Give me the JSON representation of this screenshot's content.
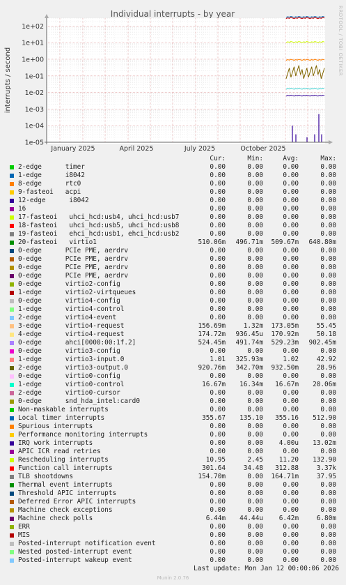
{
  "chart_data": {
    "type": "line",
    "title": "Individual interrupts - by year",
    "ylabel": "interrupts / second",
    "yscale": "log",
    "ylim": [
      1e-05,
      300
    ],
    "y_ticks": [
      "1e+02",
      "1e+01",
      "1e+00",
      "1e-01",
      "1e-02",
      "1e-03",
      "1e-04",
      "1e-05"
    ],
    "x_ticks": [
      "January 2025",
      "April 2025",
      "July 2025",
      "October 2025"
    ],
    "grid": true,
    "side_label": "RRDTOOL / TOBI OETIKER",
    "series": [
      {
        "name": "Function call interrupts",
        "color": "#cc0000",
        "values": [
          301.64
        ]
      },
      {
        "name": "Local timer interrupts",
        "color": "#0066b3",
        "values": [
          355.67
        ]
      },
      {
        "name": "Rescheduling interrupts",
        "color": "#ccff00",
        "values": [
          10.95
        ]
      },
      {
        "name": "virtio3-output.0",
        "color": "#ff8000",
        "values": [
          0.92
        ]
      },
      {
        "name": "virtio4-request",
        "color": "#806600",
        "values": [
          0.17
        ]
      },
      {
        "name": "virtio0-control",
        "color": "#33cccc",
        "values": [
          0.0167
        ]
      },
      {
        "name": "Machine check polls",
        "color": "#330099",
        "values": [
          0.0064
        ]
      }
    ]
  },
  "legend": {
    "headers": [
      "Cur:",
      "Min:",
      "Avg:",
      "Max:"
    ],
    "rows": [
      {
        "label": "2-edge      timer",
        "color": "#00cc00",
        "cur": "0.00",
        "min": "0.00",
        "avg": "0.00",
        "max": "0.00"
      },
      {
        "label": "1-edge      i8042",
        "color": "#0066b3",
        "cur": "0.00",
        "min": "0.00",
        "avg": "0.00",
        "max": "0.00"
      },
      {
        "label": "8-edge      rtc0",
        "color": "#ff8000",
        "cur": "0.00",
        "min": "0.00",
        "avg": "0.00",
        "max": "0.00"
      },
      {
        "label": "9-fasteoi   acpi",
        "color": "#ffcc00",
        "cur": "0.00",
        "min": "0.00",
        "avg": "0.00",
        "max": "0.00"
      },
      {
        "label": "12-edge      i8042",
        "color": "#330099",
        "cur": "0.00",
        "min": "0.00",
        "avg": "0.00",
        "max": "0.00"
      },
      {
        "label": "16",
        "color": "#990099",
        "cur": "0.00",
        "min": "0.00",
        "avg": "0.00",
        "max": "0.00"
      },
      {
        "label": "17-fasteoi   uhci_hcd:usb4, uhci_hcd:usb7",
        "color": "#ccff00",
        "cur": "0.00",
        "min": "0.00",
        "avg": "0.00",
        "max": "0.00"
      },
      {
        "label": "18-fasteoi   uhci_hcd:usb5, uhci_hcd:usb8",
        "color": "#ff0000",
        "cur": "0.00",
        "min": "0.00",
        "avg": "0.00",
        "max": "0.00"
      },
      {
        "label": "19-fasteoi   ehci_hcd:usb1, ehci_hcd:usb2",
        "color": "#808080",
        "cur": "0.00",
        "min": "0.00",
        "avg": "0.00",
        "max": "0.00"
      },
      {
        "label": "20-fasteoi   virtio1",
        "color": "#008f00",
        "cur": "510.06m",
        "min": "496.71m",
        "avg": "509.67m",
        "max": "640.80m"
      },
      {
        "label": "0-edge      PCIe PME, aerdrv",
        "color": "#00487d",
        "cur": "0.00",
        "min": "0.00",
        "avg": "0.00",
        "max": "0.00"
      },
      {
        "label": "0-edge      PCIe PME, aerdrv",
        "color": "#b35a00",
        "cur": "0.00",
        "min": "0.00",
        "avg": "0.00",
        "max": "0.00"
      },
      {
        "label": "0-edge      PCIe PME, aerdrv",
        "color": "#b38f00",
        "cur": "0.00",
        "min": "0.00",
        "avg": "0.00",
        "max": "0.00"
      },
      {
        "label": "0-edge      PCIe PME, aerdrv",
        "color": "#6b006b",
        "cur": "0.00",
        "min": "0.00",
        "avg": "0.00",
        "max": "0.00"
      },
      {
        "label": "0-edge      virtio2-config",
        "color": "#8fb300",
        "cur": "0.00",
        "min": "0.00",
        "avg": "0.00",
        "max": "0.00"
      },
      {
        "label": "1-edge      virtio2-virtqueues",
        "color": "#b30000",
        "cur": "0.00",
        "min": "0.00",
        "avg": "0.00",
        "max": "0.00"
      },
      {
        "label": "0-edge      virtio4-config",
        "color": "#bebebe",
        "cur": "0.00",
        "min": "0.00",
        "avg": "0.00",
        "max": "0.00"
      },
      {
        "label": "1-edge      virtio4-control",
        "color": "#80ff80",
        "cur": "0.00",
        "min": "0.00",
        "avg": "0.00",
        "max": "0.00"
      },
      {
        "label": "2-edge      virtio4-event",
        "color": "#80c9ff",
        "cur": "0.00",
        "min": "0.00",
        "avg": "0.00",
        "max": "0.00"
      },
      {
        "label": "3-edge      virtio4-request",
        "color": "#ffc080",
        "cur": "156.69m",
        "min": "1.32m",
        "avg": "173.05m",
        "max": "55.45"
      },
      {
        "label": "4-edge      virtio4-request",
        "color": "#ffe680",
        "cur": "174.72m",
        "min": "936.45u",
        "avg": "170.92m",
        "max": "50.18"
      },
      {
        "label": "0-edge      ahci[0000:00:1f.2]",
        "color": "#aa80ff",
        "cur": "524.45m",
        "min": "491.74m",
        "avg": "529.23m",
        "max": "902.45m"
      },
      {
        "label": "0-edge      virtio3-config",
        "color": "#ee00cc",
        "cur": "0.00",
        "min": "0.00",
        "avg": "0.00",
        "max": "0.00"
      },
      {
        "label": "1-edge      virtio3-input.0",
        "color": "#ff8080",
        "cur": "1.01",
        "min": "325.93m",
        "avg": "1.02",
        "max": "42.92"
      },
      {
        "label": "2-edge      virtio3-output.0",
        "color": "#666600",
        "cur": "920.76m",
        "min": "342.70m",
        "avg": "932.50m",
        "max": "28.96"
      },
      {
        "label": "0-edge      virtio0-config",
        "color": "#ffbfff",
        "cur": "0.00",
        "min": "0.00",
        "avg": "0.00",
        "max": "0.00"
      },
      {
        "label": "1-edge      virtio0-control",
        "color": "#00ffcc",
        "cur": "16.67m",
        "min": "16.34m",
        "avg": "16.67m",
        "max": "20.06m"
      },
      {
        "label": "2-edge      virtio0-cursor",
        "color": "#cc6699",
        "cur": "0.00",
        "min": "0.00",
        "avg": "0.00",
        "max": "0.00"
      },
      {
        "label": "0-edge      snd_hda_intel:card0",
        "color": "#999900",
        "cur": "0.00",
        "min": "0.00",
        "avg": "0.00",
        "max": "0.00"
      },
      {
        "label": "Non-maskable interrupts",
        "color": "#00cc00",
        "cur": "0.00",
        "min": "0.00",
        "avg": "0.00",
        "max": "0.00"
      },
      {
        "label": "Local timer interrupts",
        "color": "#0066b3",
        "cur": "355.67",
        "min": "135.10",
        "avg": "355.16",
        "max": "512.90"
      },
      {
        "label": "Spurious interrupts",
        "color": "#ff8000",
        "cur": "0.00",
        "min": "0.00",
        "avg": "0.00",
        "max": "0.00"
      },
      {
        "label": "Performance monitoring interrupts",
        "color": "#ffcc00",
        "cur": "0.00",
        "min": "0.00",
        "avg": "0.00",
        "max": "0.00"
      },
      {
        "label": "IRQ work interrupts",
        "color": "#330099",
        "cur": "0.00",
        "min": "0.00",
        "avg": "4.00u",
        "max": "13.02m"
      },
      {
        "label": "APIC ICR read retries",
        "color": "#990099",
        "cur": "0.00",
        "min": "0.00",
        "avg": "0.00",
        "max": "0.00"
      },
      {
        "label": "Rescheduling interrupts",
        "color": "#ccff00",
        "cur": "10.95",
        "min": "2.45",
        "avg": "11.20",
        "max": "132.90"
      },
      {
        "label": "Function call interrupts",
        "color": "#ff0000",
        "cur": "301.64",
        "min": "34.48",
        "avg": "312.88",
        "max": "3.37k"
      },
      {
        "label": "TLB shootdowns",
        "color": "#808080",
        "cur": "154.70m",
        "min": "0.00",
        "avg": "164.71m",
        "max": "37.95"
      },
      {
        "label": "Thermal event interrupts",
        "color": "#008f00",
        "cur": "0.00",
        "min": "0.00",
        "avg": "0.00",
        "max": "0.00"
      },
      {
        "label": "Threshold APIC interrupts",
        "color": "#00487d",
        "cur": "0.00",
        "min": "0.00",
        "avg": "0.00",
        "max": "0.00"
      },
      {
        "label": "Deferred Error APIC interrupts",
        "color": "#b35a00",
        "cur": "0.00",
        "min": "0.00",
        "avg": "0.00",
        "max": "0.00"
      },
      {
        "label": "Machine check exceptions",
        "color": "#b38f00",
        "cur": "0.00",
        "min": "0.00",
        "avg": "0.00",
        "max": "0.00"
      },
      {
        "label": "Machine check polls",
        "color": "#6b006b",
        "cur": "6.44m",
        "min": "44.44u",
        "avg": "6.42m",
        "max": "6.80m"
      },
      {
        "label": "ERR",
        "color": "#8fb300",
        "cur": "0.00",
        "min": "0.00",
        "avg": "0.00",
        "max": "0.00"
      },
      {
        "label": "MIS",
        "color": "#b30000",
        "cur": "0.00",
        "min": "0.00",
        "avg": "0.00",
        "max": "0.00"
      },
      {
        "label": "Posted-interrupt notification event",
        "color": "#bebebe",
        "cur": "0.00",
        "min": "0.00",
        "avg": "0.00",
        "max": "0.00"
      },
      {
        "label": "Nested posted-interrupt event",
        "color": "#80ff80",
        "cur": "0.00",
        "min": "0.00",
        "avg": "0.00",
        "max": "0.00"
      },
      {
        "label": "Posted-interrupt wakeup event",
        "color": "#80c9ff",
        "cur": "0.00",
        "min": "0.00",
        "avg": "0.00",
        "max": "0.00"
      }
    ]
  },
  "footer": {
    "last_update": "Last update: Mon Jan 12 00:00:06 2026",
    "munin": "Munin 2.0.76"
  }
}
